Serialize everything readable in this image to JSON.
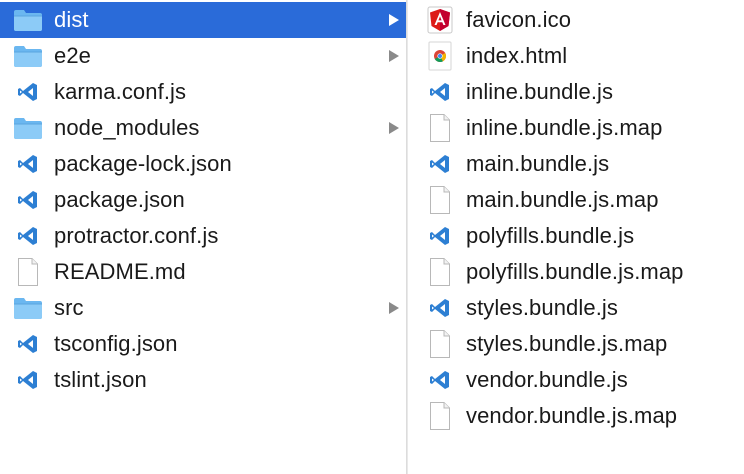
{
  "left_column": {
    "items": [
      {
        "label": "dist",
        "type": "folder",
        "icon": "folder-icon",
        "expandable": true,
        "selected": true
      },
      {
        "label": "e2e",
        "type": "folder",
        "icon": "folder-icon",
        "expandable": true,
        "selected": false
      },
      {
        "label": "karma.conf.js",
        "type": "file",
        "icon": "vscode-file-icon",
        "expandable": false,
        "selected": false
      },
      {
        "label": "node_modules",
        "type": "folder",
        "icon": "folder-icon",
        "expandable": true,
        "selected": false
      },
      {
        "label": "package-lock.json",
        "type": "file",
        "icon": "vscode-file-icon",
        "expandable": false,
        "selected": false
      },
      {
        "label": "package.json",
        "type": "file",
        "icon": "vscode-file-icon",
        "expandable": false,
        "selected": false
      },
      {
        "label": "protractor.conf.js",
        "type": "file",
        "icon": "vscode-file-icon",
        "expandable": false,
        "selected": false
      },
      {
        "label": "README.md",
        "type": "file",
        "icon": "blank-document-icon",
        "expandable": false,
        "selected": false
      },
      {
        "label": "src",
        "type": "folder",
        "icon": "folder-icon",
        "expandable": true,
        "selected": false
      },
      {
        "label": "tsconfig.json",
        "type": "file",
        "icon": "vscode-file-icon",
        "expandable": false,
        "selected": false
      },
      {
        "label": "tslint.json",
        "type": "file",
        "icon": "vscode-file-icon",
        "expandable": false,
        "selected": false
      }
    ]
  },
  "right_column": {
    "items": [
      {
        "label": "favicon.ico",
        "type": "file",
        "icon": "angular-logo-icon"
      },
      {
        "label": "index.html",
        "type": "file",
        "icon": "chrome-logo-icon"
      },
      {
        "label": "inline.bundle.js",
        "type": "file",
        "icon": "vscode-file-icon"
      },
      {
        "label": "inline.bundle.js.map",
        "type": "file",
        "icon": "blank-document-icon"
      },
      {
        "label": "main.bundle.js",
        "type": "file",
        "icon": "vscode-file-icon"
      },
      {
        "label": "main.bundle.js.map",
        "type": "file",
        "icon": "blank-document-icon"
      },
      {
        "label": "polyfills.bundle.js",
        "type": "file",
        "icon": "vscode-file-icon"
      },
      {
        "label": "polyfills.bundle.js.map",
        "type": "file",
        "icon": "blank-document-icon"
      },
      {
        "label": "styles.bundle.js",
        "type": "file",
        "icon": "vscode-file-icon"
      },
      {
        "label": "styles.bundle.js.map",
        "type": "file",
        "icon": "blank-document-icon"
      },
      {
        "label": "vendor.bundle.js",
        "type": "file",
        "icon": "vscode-file-icon"
      },
      {
        "label": "vendor.bundle.js.map",
        "type": "file",
        "icon": "blank-document-icon"
      }
    ]
  },
  "colors": {
    "selection": "#2a6bd9",
    "folder": "#6bb7f0",
    "vscode_blue": "#2d7fd3",
    "angular_red": "#dd1b16",
    "text": "#1a1a1a"
  }
}
